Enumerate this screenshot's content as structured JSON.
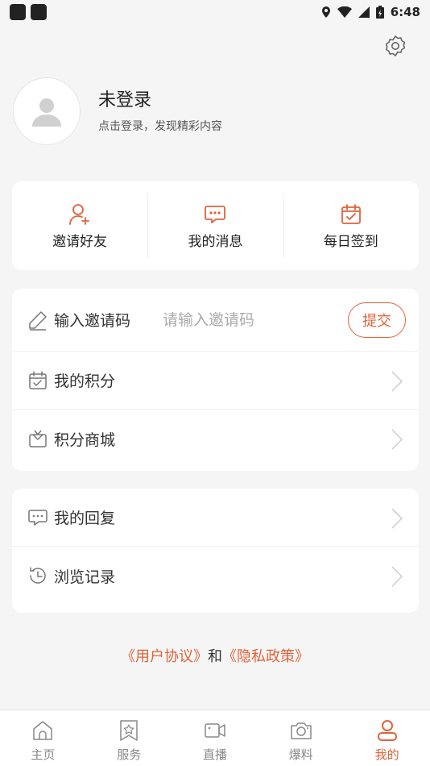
{
  "status_bar": {
    "time": "6:48"
  },
  "profile": {
    "name": "未登录",
    "subtitle": "点击登录，发现精彩内容"
  },
  "quick_actions": [
    {
      "label": "邀请好友",
      "icon": "add-user-icon"
    },
    {
      "label": "我的消息",
      "icon": "message-icon"
    },
    {
      "label": "每日签到",
      "icon": "calendar-check-icon"
    }
  ],
  "invite": {
    "label": "输入邀请码",
    "placeholder": "请输入邀请码",
    "submit_label": "提交"
  },
  "menu_group1": [
    {
      "label": "我的积分",
      "icon": "points-calendar-icon"
    },
    {
      "label": "积分商城",
      "icon": "gift-box-icon"
    }
  ],
  "menu_group2": [
    {
      "label": "我的回复",
      "icon": "chat-bubble-icon"
    },
    {
      "label": "浏览记录",
      "icon": "history-icon"
    }
  ],
  "agreement": {
    "user_agreement": "《用户协议》",
    "conjunction": "和",
    "privacy_policy": "《隐私政策》"
  },
  "tabs": [
    {
      "label": "主页",
      "icon": "home-icon",
      "active": false
    },
    {
      "label": "服务",
      "icon": "star-bookmark-icon",
      "active": false
    },
    {
      "label": "直播",
      "icon": "video-camera-icon",
      "active": false
    },
    {
      "label": "爆料",
      "icon": "camera-icon",
      "active": false
    },
    {
      "label": "我的",
      "icon": "user-icon",
      "active": true
    }
  ],
  "colors": {
    "accent": "#e0633a",
    "background": "#f5f5f5",
    "card": "#ffffff"
  }
}
